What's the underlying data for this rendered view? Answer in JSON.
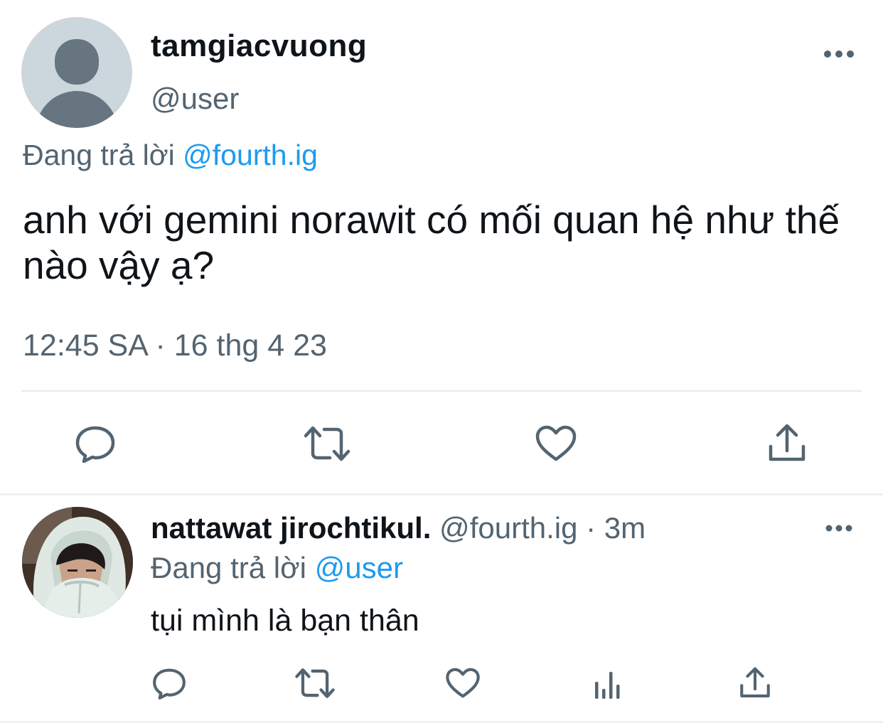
{
  "main_tweet": {
    "display_name": "tamgiacvuong",
    "handle": "@user",
    "replying_prefix": "Đang trả lời ",
    "replying_to": "@fourth.ig",
    "text": "anh với gemini norawit có mối quan hệ như thế nào vậy ạ?",
    "timestamp": "12:45 SA · 16 thg 4 23",
    "actions": [
      "reply-icon",
      "retweet-icon",
      "like-icon",
      "share-icon"
    ]
  },
  "reply_tweet": {
    "display_name": "nattawat jirochtikul.",
    "meta": " @fourth.ig · 3m",
    "replying_prefix": "Đang trả lời ",
    "replying_to": "@user",
    "text": "tụi mình là bạn thân",
    "actions": [
      "reply-icon",
      "retweet-icon",
      "like-icon",
      "analytics-icon",
      "share-icon"
    ]
  },
  "colors": {
    "text_primary": "#0f1419",
    "text_secondary": "#536471",
    "link": "#1d9bf0",
    "avatar_bg": "#ccd6dd",
    "avatar_fg": "#66757f"
  }
}
